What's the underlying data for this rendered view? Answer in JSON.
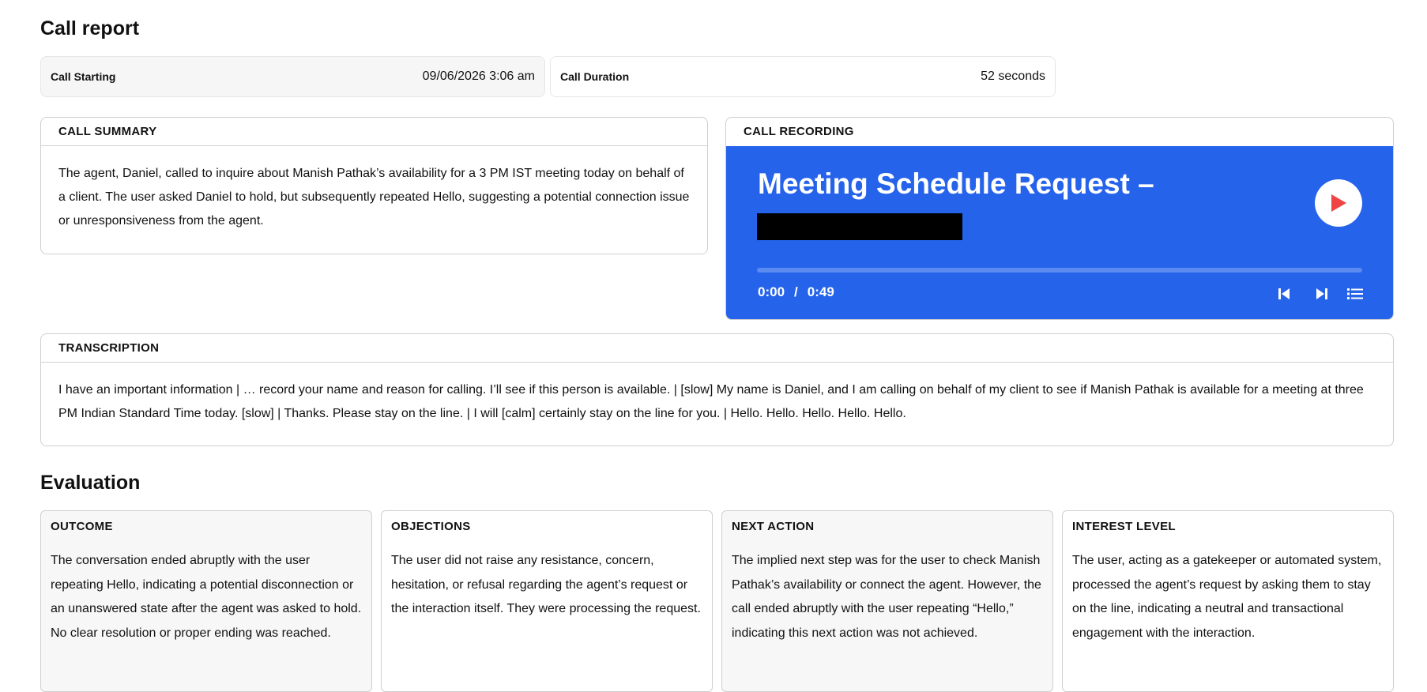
{
  "page": {
    "title": "Call report"
  },
  "stats": {
    "call_starting": {
      "label": "Call Starting",
      "value": "09/06/2026 3:06 am"
    },
    "call_duration": {
      "label": "Call Duration",
      "value": "52 seconds"
    }
  },
  "summary": {
    "heading": "CALL SUMMARY",
    "text": "The agent, Daniel, called to inquire about Manish Pathak’s availability for a 3 PM IST meeting today on behalf of a client. The user asked Daniel to hold, but subsequently repeated Hello, suggesting a potential connection issue or unresponsiveness from the agent."
  },
  "recording": {
    "heading": "CALL RECORDING",
    "title": "Meeting Schedule Request –",
    "current_time": "0:00",
    "separator": "/",
    "total_time": "0:49",
    "progress": 0,
    "accent_color": "#2563eb",
    "play_color": "#ef4444",
    "icons": {
      "play": "play-icon",
      "prev": "skip-previous-icon",
      "next": "skip-next-icon",
      "list": "playlist-icon"
    }
  },
  "transcription": {
    "heading": "TRANSCRIPTION",
    "text": "I have an important information | … record your name and reason for calling. I’ll see if this person is available. | [slow] My name is Daniel, and I am calling on behalf of my client to see if Manish Pathak is available for a meeting at three PM Indian Standard Time today. [slow] | Thanks. Please stay on the line. | I will [calm] certainly stay on the line for you. | Hello. Hello. Hello. Hello. Hello."
  },
  "evaluation": {
    "heading": "Evaluation",
    "cards": [
      {
        "title": "OUTCOME",
        "text": "The conversation ended abruptly with the user repeating Hello, indicating a potential disconnection or an unanswered state after the agent was asked to hold. No clear resolution or proper ending was reached."
      },
      {
        "title": "OBJECTIONS",
        "text": "The user did not raise any resistance, concern, hesitation, or refusal regarding the agent’s request or the interaction itself. They were processing the request."
      },
      {
        "title": "NEXT ACTION",
        "text": "The implied next step was for the user to check Manish Pathak’s availability or connect the agent. However, the call ended abruptly with the user repeating “Hello,” indicating this next action was not achieved."
      },
      {
        "title": "INTEREST LEVEL",
        "text": "The user, acting as a gatekeeper or automated system, processed the agent’s request by asking them to stay on the line, indicating a neutral and transactional engagement with the interaction."
      }
    ]
  }
}
